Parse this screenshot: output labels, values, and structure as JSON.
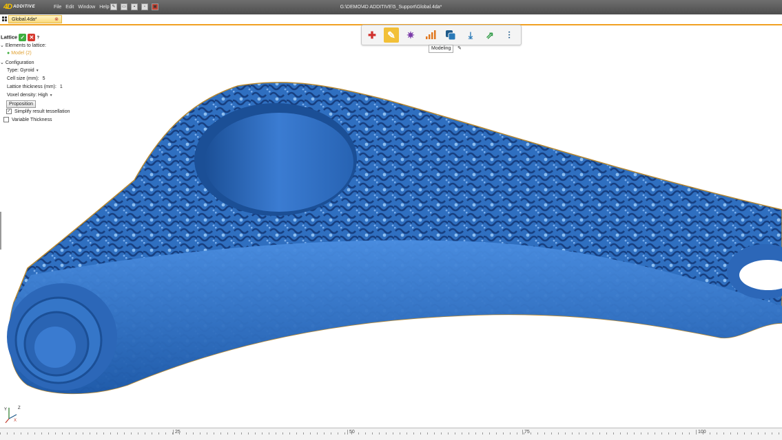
{
  "app": {
    "logo_mark": "4D",
    "logo_word": "ADDITIVE",
    "window_title": "G:\\DEMO\\4D ADDITIVE\\5_Support\\Global.4da*",
    "menu": [
      "File",
      "Edit",
      "Window",
      "Help"
    ]
  },
  "tab": {
    "label": "Global.4da*",
    "close": "⊗"
  },
  "panel": {
    "title": "Lattice",
    "elements_heading": "Elements to lattice:",
    "element_item": "Model (2)",
    "configuration_heading": "Configuration",
    "type_label": "Type:",
    "type_value": "Gyroid",
    "cell_size_label": "Cell size (mm):",
    "cell_size_value": "5",
    "thickness_label": "Lattice thickness (mm):",
    "thickness_value": "1",
    "voxel_label": "Voxel density:",
    "voxel_value": "High",
    "proposition_button": "Proposition",
    "simplify_label": "Simplify result tessellation",
    "simplify_checked": true,
    "variable_label": "Variable Thickness",
    "variable_checked": false
  },
  "toolbar": {
    "icons": [
      "add-icon",
      "wrench-icon",
      "star-icon",
      "chart-icon",
      "copy-icon",
      "download-icon",
      "export-icon",
      "screw-icon"
    ],
    "active_index": 1,
    "tooltip": "Modeling"
  },
  "axes": {
    "z": "Z",
    "y": "Y",
    "x": "X"
  },
  "ruler": {
    "labels": [
      "25",
      "50",
      "75",
      "100"
    ]
  },
  "colors": {
    "model": "#2f6fc0",
    "accent": "#f0a020"
  }
}
